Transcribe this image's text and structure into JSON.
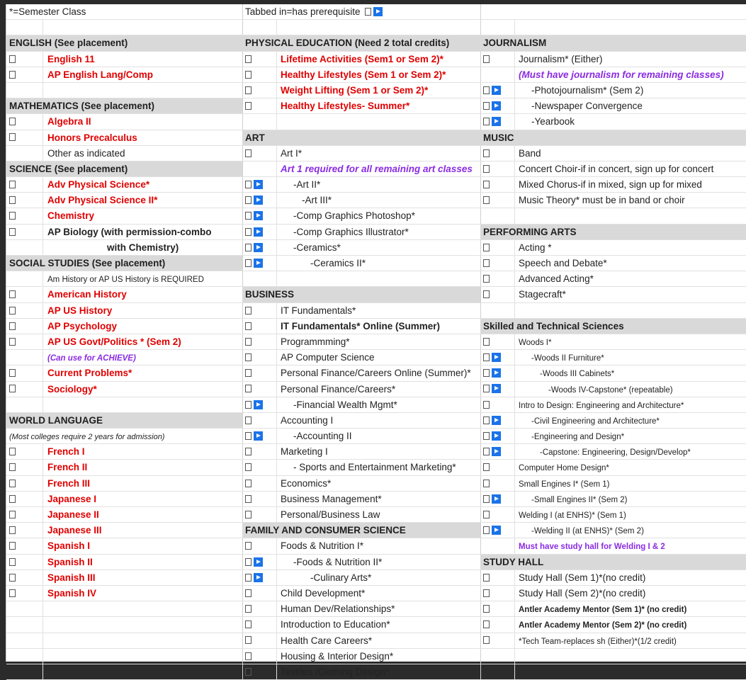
{
  "col1": [
    {
      "kind": "top",
      "text": "*=Semester Class"
    },
    {
      "kind": "gap"
    },
    {
      "kind": "hdr",
      "text": "ENGLISH (See placement)"
    },
    {
      "kind": "item",
      "cb": true,
      "text": "English 11",
      "style": "red"
    },
    {
      "kind": "item",
      "cb": true,
      "text": "AP English Lang/Comp",
      "style": "red"
    },
    {
      "kind": "gap"
    },
    {
      "kind": "hdr",
      "text": "MATHEMATICS (See placement)"
    },
    {
      "kind": "item",
      "cb": true,
      "text": "Algebra II",
      "style": "red"
    },
    {
      "kind": "item",
      "cb": true,
      "text": "Honors Precalculus",
      "style": "red"
    },
    {
      "kind": "item",
      "cb": false,
      "text": "Other as indicated",
      "style": "plain"
    },
    {
      "kind": "hdr",
      "text": "SCIENCE (See placement)"
    },
    {
      "kind": "item",
      "cb": true,
      "text": "Adv Physical Science*",
      "style": "red"
    },
    {
      "kind": "item",
      "cb": true,
      "text": "Adv Physical Science II*",
      "style": "red"
    },
    {
      "kind": "item",
      "cb": true,
      "text": "Chemistry",
      "style": "red"
    },
    {
      "kind": "item",
      "cb": true,
      "text": "AP Biology (with permission-combo",
      "style": "bold"
    },
    {
      "kind": "item",
      "cb": false,
      "text": "with Chemistry)",
      "style": "boldctr"
    },
    {
      "kind": "hdr",
      "text": "SOCIAL STUDIES (See placement)"
    },
    {
      "kind": "item",
      "cb": false,
      "text": "Am History or AP US History is REQUIRED",
      "style": "small"
    },
    {
      "kind": "item",
      "cb": true,
      "text": "American History",
      "style": "red"
    },
    {
      "kind": "item",
      "cb": true,
      "text": "AP US History",
      "style": "red"
    },
    {
      "kind": "item",
      "cb": true,
      "text": "AP Psychology",
      "style": "red"
    },
    {
      "kind": "item",
      "cb": true,
      "text": "AP US Govt/Politics * (Sem 2)",
      "style": "red"
    },
    {
      "kind": "item",
      "cb": false,
      "text": "(Can use for ACHIEVE)",
      "style": "purplesmall"
    },
    {
      "kind": "item",
      "cb": true,
      "text": "Current Problems*",
      "style": "red"
    },
    {
      "kind": "item",
      "cb": true,
      "text": "Sociology*",
      "style": "red"
    },
    {
      "kind": "gap"
    },
    {
      "kind": "hdr",
      "text": "WORLD LANGUAGE"
    },
    {
      "kind": "note",
      "text": "(Most colleges require 2 years for admission)"
    },
    {
      "kind": "item",
      "cb": true,
      "text": "French I",
      "style": "red"
    },
    {
      "kind": "item",
      "cb": true,
      "text": "French II",
      "style": "red"
    },
    {
      "kind": "item",
      "cb": true,
      "text": "French III",
      "style": "red"
    },
    {
      "kind": "item",
      "cb": true,
      "text": "Japanese I",
      "style": "red"
    },
    {
      "kind": "item",
      "cb": true,
      "text": "Japanese II",
      "style": "red"
    },
    {
      "kind": "item",
      "cb": true,
      "text": "Japanese III",
      "style": "red"
    },
    {
      "kind": "item",
      "cb": true,
      "text": "Spanish I",
      "style": "red"
    },
    {
      "kind": "item",
      "cb": true,
      "text": "Spanish II",
      "style": "red"
    },
    {
      "kind": "item",
      "cb": true,
      "text": "Spanish III",
      "style": "red"
    },
    {
      "kind": "item",
      "cb": true,
      "text": "Spanish IV",
      "style": "red"
    },
    {
      "kind": "gap"
    },
    {
      "kind": "gap"
    },
    {
      "kind": "gap"
    },
    {
      "kind": "gap"
    },
    {
      "kind": "gap"
    }
  ],
  "col2": [
    {
      "kind": "top",
      "text": "Tabbed in=has prerequisite",
      "play": true
    },
    {
      "kind": "gap"
    },
    {
      "kind": "hdr",
      "text": "PHYSICAL EDUCATION (Need 2 total credits)"
    },
    {
      "kind": "item",
      "cb": true,
      "text": "Lifetime Activities (Sem1 or Sem 2)*",
      "style": "red"
    },
    {
      "kind": "item",
      "cb": true,
      "text": "Healthy Lifestyles (Sem 1 or Sem 2)*",
      "style": "red"
    },
    {
      "kind": "item",
      "cb": true,
      "text": "Weight Lifting (Sem 1 or Sem 2)*",
      "style": "red"
    },
    {
      "kind": "item",
      "cb": true,
      "text": "Healthy Lifestyles- Summer*",
      "style": "red"
    },
    {
      "kind": "gap"
    },
    {
      "kind": "hdr",
      "text": "ART"
    },
    {
      "kind": "item",
      "cb": true,
      "text": "Art I*",
      "style": "plain"
    },
    {
      "kind": "item",
      "cb": false,
      "text": "Art 1 required for all remaining art classes",
      "style": "purple"
    },
    {
      "kind": "item",
      "cb": true,
      "play": true,
      "text": "-Art II*",
      "style": "ind1"
    },
    {
      "kind": "item",
      "cb": true,
      "play": true,
      "text": "-Art III*",
      "style": "ind2"
    },
    {
      "kind": "item",
      "cb": true,
      "play": true,
      "text": "-Comp Graphics Photoshop*",
      "style": "ind1"
    },
    {
      "kind": "item",
      "cb": true,
      "play": true,
      "text": "-Comp Graphics Illustrator*",
      "style": "ind1"
    },
    {
      "kind": "item",
      "cb": true,
      "play": true,
      "text": "-Ceramics*",
      "style": "ind1"
    },
    {
      "kind": "item",
      "cb": true,
      "play": true,
      "text": "-Ceramics II*",
      "style": "ind3"
    },
    {
      "kind": "gap"
    },
    {
      "kind": "hdr",
      "text": "BUSINESS"
    },
    {
      "kind": "item",
      "cb": true,
      "text": "IT Fundamentals*",
      "style": "plain"
    },
    {
      "kind": "item",
      "cb": true,
      "text": "IT Fundamentals* Online (Summer)",
      "style": "bold"
    },
    {
      "kind": "item",
      "cb": true,
      "text": "Programmming*",
      "style": "plain"
    },
    {
      "kind": "item",
      "cb": true,
      "text": "AP Computer Science",
      "style": "plain"
    },
    {
      "kind": "item",
      "cb": true,
      "text": "Personal Finance/Careers Online (Summer)*",
      "style": "plain"
    },
    {
      "kind": "item",
      "cb": true,
      "text": "Personal Finance/Careers*",
      "style": "plain"
    },
    {
      "kind": "item",
      "cb": true,
      "play": true,
      "text": "-Financial Wealth Mgmt*",
      "style": "ind1"
    },
    {
      "kind": "item",
      "cb": true,
      "text": "Accounting I",
      "style": "plain"
    },
    {
      "kind": "item",
      "cb": true,
      "play": true,
      "text": "-Accounting II",
      "style": "ind1"
    },
    {
      "kind": "item",
      "cb": true,
      "text": "Marketing I",
      "style": "plain"
    },
    {
      "kind": "item",
      "cb": true,
      "text": "- Sports and Entertainment Marketing*",
      "style": "ind1"
    },
    {
      "kind": "item",
      "cb": true,
      "text": "Economics*",
      "style": "plain"
    },
    {
      "kind": "item",
      "cb": true,
      "text": "Business Management*",
      "style": "plain"
    },
    {
      "kind": "item",
      "cb": true,
      "text": "Personal/Business Law",
      "style": "plain"
    },
    {
      "kind": "hdr",
      "text": "FAMILY AND CONSUMER SCIENCE"
    },
    {
      "kind": "item",
      "cb": true,
      "text": "Foods & Nutrition I*",
      "style": "plain"
    },
    {
      "kind": "item",
      "cb": true,
      "play": true,
      "text": "-Foods & Nutrition II*",
      "style": "ind1"
    },
    {
      "kind": "item",
      "cb": true,
      "play": true,
      "text": "-Culinary Arts*",
      "style": "ind3"
    },
    {
      "kind": "item",
      "cb": true,
      "text": "Child Development*",
      "style": "plain"
    },
    {
      "kind": "item",
      "cb": true,
      "text": "Human Dev/Relationships*",
      "style": "plain"
    },
    {
      "kind": "item",
      "cb": true,
      "text": "Introduction to Education*",
      "style": "plain"
    },
    {
      "kind": "item",
      "cb": true,
      "text": "Health Care Careers*",
      "style": "plain"
    },
    {
      "kind": "item",
      "cb": true,
      "text": "Housing & Interior Design*",
      "style": "plain"
    },
    {
      "kind": "item",
      "cb": true,
      "text": "Textiles /Clothing Design*",
      "style": "plain"
    }
  ],
  "col3": [
    {
      "kind": "top",
      "text": ""
    },
    {
      "kind": "gap"
    },
    {
      "kind": "hdr",
      "text": "JOURNALISM"
    },
    {
      "kind": "item",
      "cb": true,
      "text": "Journalism* (Either)",
      "style": "plain"
    },
    {
      "kind": "item",
      "cb": false,
      "text": "(Must have journalism for remaining classes)",
      "style": "purple"
    },
    {
      "kind": "item",
      "cb": true,
      "play": true,
      "text": "-Photojournalism* (Sem 2)",
      "style": "ind1"
    },
    {
      "kind": "item",
      "cb": true,
      "play": true,
      "text": "-Newspaper Convergence",
      "style": "ind1"
    },
    {
      "kind": "item",
      "cb": true,
      "play": true,
      "text": "-Yearbook",
      "style": "ind1"
    },
    {
      "kind": "hdr",
      "text": "MUSIC"
    },
    {
      "kind": "item",
      "cb": true,
      "text": "Band",
      "style": "plain"
    },
    {
      "kind": "item",
      "cb": true,
      "text": "Concert Choir-if in concert, sign up for concert",
      "style": "plain"
    },
    {
      "kind": "item",
      "cb": true,
      "text": "Mixed Chorus-if in mixed, sign up for mixed",
      "style": "plain"
    },
    {
      "kind": "item",
      "cb": true,
      "text": "Music Theory* must be in band or choir",
      "style": "plain"
    },
    {
      "kind": "gap"
    },
    {
      "kind": "hdr",
      "text": "PERFORMING ARTS"
    },
    {
      "kind": "item",
      "cb": true,
      "text": "Acting *",
      "style": "plain"
    },
    {
      "kind": "item",
      "cb": true,
      "text": "Speech and Debate*",
      "style": "plain"
    },
    {
      "kind": "item",
      "cb": true,
      "text": "Advanced Acting*",
      "style": "plain"
    },
    {
      "kind": "item",
      "cb": true,
      "text": "Stagecraft*",
      "style": "plain"
    },
    {
      "kind": "gap"
    },
    {
      "kind": "hdr",
      "text": "Skilled and Technical Sciences"
    },
    {
      "kind": "item",
      "cb": true,
      "text": "Woods I*",
      "style": "small"
    },
    {
      "kind": "item",
      "cb": true,
      "play": true,
      "text": "-Woods II Furniture*",
      "style": "small ind1"
    },
    {
      "kind": "item",
      "cb": true,
      "play": true,
      "text": "-Woods III Cabinets*",
      "style": "small ind2"
    },
    {
      "kind": "item",
      "cb": true,
      "play": true,
      "text": "-Woods IV-Capstone* (repeatable)",
      "style": "small ind3"
    },
    {
      "kind": "item",
      "cb": true,
      "text": "Intro to Design: Engineering and Architecture*",
      "style": "small"
    },
    {
      "kind": "item",
      "cb": true,
      "play": true,
      "text": "-Civil Engineering and Architecture*",
      "style": "small ind1"
    },
    {
      "kind": "item",
      "cb": true,
      "play": true,
      "text": "-Engineering and Design*",
      "style": "small ind1"
    },
    {
      "kind": "item",
      "cb": true,
      "play": true,
      "text": "-Capstone: Engineering, Design/Develop*",
      "style": "small ind2"
    },
    {
      "kind": "item",
      "cb": true,
      "text": "Computer Home Design*",
      "style": "small"
    },
    {
      "kind": "item",
      "cb": true,
      "text": "Small Engines I* (Sem 1)",
      "style": "small"
    },
    {
      "kind": "item",
      "cb": true,
      "play": true,
      "text": "-Small Engines II* (Sem 2)",
      "style": "small ind1"
    },
    {
      "kind": "item",
      "cb": true,
      "text": "Welding I (at ENHS)* (Sem 1)",
      "style": "small"
    },
    {
      "kind": "item",
      "cb": true,
      "play": true,
      "text": "-Welding II (at ENHS)* (Sem 2)",
      "style": "small ind1"
    },
    {
      "kind": "item",
      "cb": false,
      "text": "Must have study hall for Welding I & 2",
      "style": "purplen"
    },
    {
      "kind": "hdr",
      "text": "STUDY HALL"
    },
    {
      "kind": "item",
      "cb": true,
      "text": "Study Hall (Sem 1)*(no credit)",
      "style": "plain"
    },
    {
      "kind": "item",
      "cb": true,
      "text": "Study Hall (Sem 2)*(no credit)",
      "style": "plain"
    },
    {
      "kind": "item",
      "cb": true,
      "text": "Antler Academy Mentor (Sem 1)* (no credit)",
      "style": "bold small"
    },
    {
      "kind": "item",
      "cb": true,
      "text": "Antler Academy Mentor (Sem 2)* (no credit)",
      "style": "bold small"
    },
    {
      "kind": "item",
      "cb": true,
      "text": "*Tech Team-replaces sh (Either)*(1/2 credit)",
      "style": "small"
    },
    {
      "kind": "gap"
    },
    {
      "kind": "gap"
    }
  ]
}
